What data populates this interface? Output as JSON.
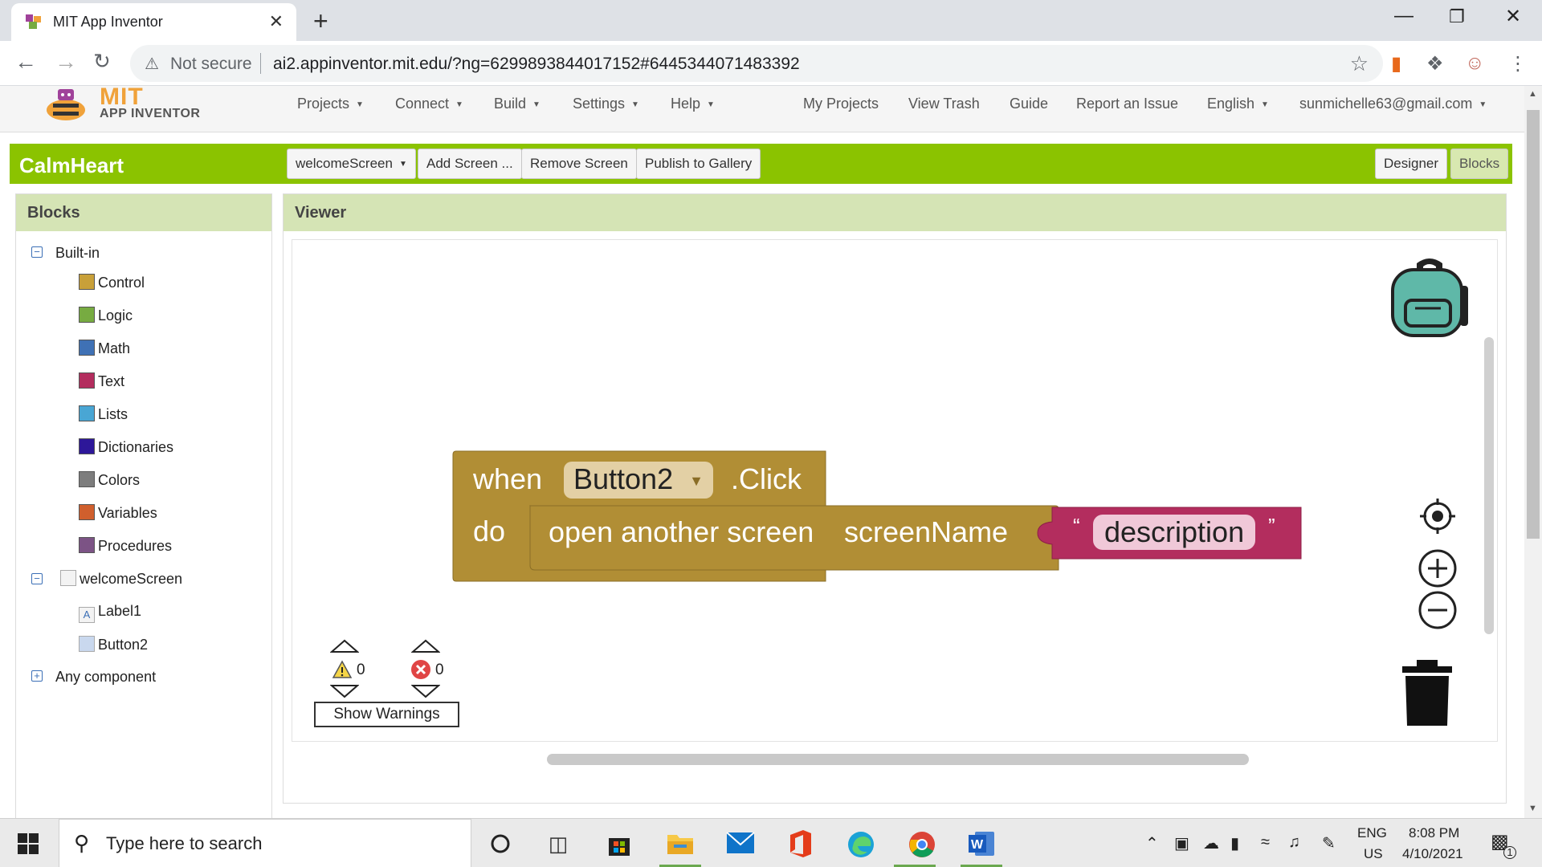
{
  "browser": {
    "tab_title": "MIT App Inventor",
    "tab_close": "✕",
    "new_tab": "+",
    "not_secure": "Not secure",
    "url": "ai2.appinventor.mit.edu/?ng=6299893844017152#6445344071483392"
  },
  "app_header": {
    "logo_mit": "MIT",
    "logo_sub": "APP INVENTOR",
    "menus_left": [
      "Projects",
      "Connect",
      "Build",
      "Settings",
      "Help"
    ],
    "links": [
      "My Projects",
      "View Trash",
      "Guide",
      "Report an Issue"
    ],
    "language": "English",
    "account": "sunmichelle63@gmail.com"
  },
  "project_bar": {
    "project_name": "CalmHeart",
    "screen_select": "welcomeScreen",
    "add_screen": "Add Screen ...",
    "remove_screen": "Remove Screen",
    "publish": "Publish to Gallery",
    "designer": "Designer",
    "blocks": "Blocks"
  },
  "blocks_panel": {
    "title": "Blocks",
    "builtin_label": "Built-in",
    "builtin": [
      {
        "label": "Control",
        "color": "#c8a039"
      },
      {
        "label": "Logic",
        "color": "#77ab41"
      },
      {
        "label": "Math",
        "color": "#3f71b5"
      },
      {
        "label": "Text",
        "color": "#b32d5e"
      },
      {
        "label": "Lists",
        "color": "#49a6d4"
      },
      {
        "label": "Dictionaries",
        "color": "#2d1799"
      },
      {
        "label": "Colors",
        "color": "#7d7d7d"
      },
      {
        "label": "Variables",
        "color": "#d05f2d"
      },
      {
        "label": "Procedures",
        "color": "#7c5385"
      }
    ],
    "screen_label": "welcomeScreen",
    "components": [
      "Label1",
      "Button2"
    ],
    "any_component": "Any component"
  },
  "viewer": {
    "title": "Viewer",
    "event_block": {
      "when": "when",
      "component": "Button2",
      "event": ".Click",
      "do": "do",
      "action": "open another screen",
      "param": "screenName",
      "open_quote": "“",
      "string_value": "description",
      "close_quote": "”"
    },
    "warnings_count": "0",
    "errors_count": "0",
    "show_warnings": "Show Warnings"
  },
  "taskbar": {
    "search_placeholder": "Type here to search",
    "lang_top": "ENG",
    "lang_bottom": "US",
    "time": "8:08 PM",
    "date": "4/10/2021",
    "notif_count": "1"
  },
  "colors": {
    "project_bar": "#8bc300",
    "panel_header": "#d5e4b5",
    "control_block": "#b18e35",
    "text_block": "#b32d5e"
  }
}
